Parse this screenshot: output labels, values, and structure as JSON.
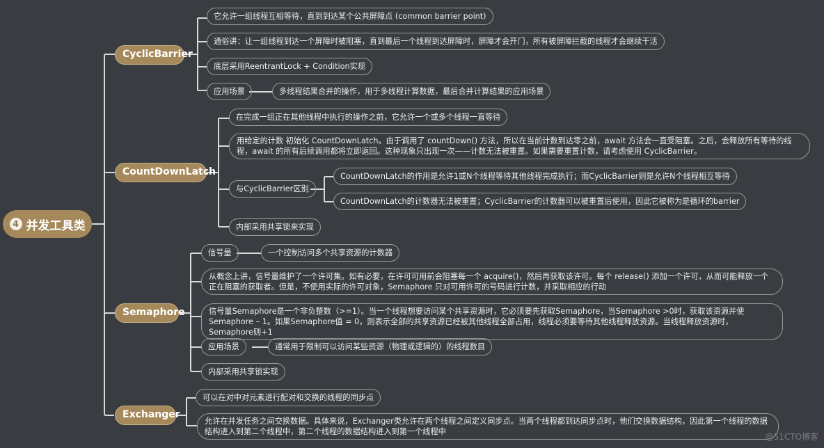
{
  "root": {
    "number": "4",
    "label": "并发工具类"
  },
  "branches": {
    "cyclic": {
      "label": "CyclicBarrier",
      "items": [
        "它允许一组线程互相等待，直到到达某个公共屏障点 (common barrier point)",
        "通俗讲：让一组线程到达一个屏障时被阻塞，直到最后一个线程到达屏障时，屏障才会开门，所有被屏障拦截的线程才会继续干活",
        "底层采用ReentrantLock + Condition实现"
      ],
      "scenario": {
        "label": "应用场景",
        "detail": "多线程结果合并的操作，用于多线程计算数据，最后合并计算结果的应用场景"
      }
    },
    "countdown": {
      "label": "CountDownLatch",
      "items": [
        "在完成一组正在其他线程中执行的操作之前，它允许一个或多个线程一直等待",
        "用给定的计数 初始化 CountDownLatch。由于调用了 countDown() 方法，所以在当前计数到达零之前，await 方法会一直受阻塞。之后，会释放所有等待的线程，await 的所有后续调用都将立即返回。这种现象只出现一次——计数无法被重置。如果需要重置计数，请考虑使用 CyclicBarrier。"
      ],
      "diff": {
        "label": "与CyclicBarrier区别",
        "items": [
          "CountDownLatch的作用是允许1或N个线程等待其他线程完成执行；而CyclicBarrier则是允许N个线程相互等待",
          "CountDownLatch的计数器无法被重置；CyclicBarrier的计数器可以被重置后使用，因此它被称为是循环的barrier"
        ]
      },
      "impl": "内部采用共享锁来实现"
    },
    "semaphore": {
      "label": "Semaphore",
      "signal": {
        "label": "信号量",
        "detail": "一个控制访问多个共享资源的计数器"
      },
      "items": [
        "从概念上讲，信号量维护了一个许可集。如有必要，在许可可用前会阻塞每一个 acquire()，然后再获取该许可。每个 release() 添加一个许可，从而可能释放一个正在阻塞的获取者。但是，不使用实际的许可对象，Semaphore 只对可用许可的号码进行计数，并采取相应的行动",
        "信号量Semaphore是一个非负整数（>=1）。当一个线程想要访问某个共享资源时，它必须要先获取Semaphore，当Semaphore >0时，获取该资源并使Semaphore – 1。如果Semaphore值 = 0，则表示全部的共享资源已经被其他线程全部占用，线程必须要等待其他线程释放资源。当线程释放资源时，Semaphore则+1"
      ],
      "scenario": {
        "label": "应用场景",
        "detail": "通常用于限制可以访问某些资源（物理或逻辑的）的线程数目"
      },
      "impl": "内部采用共享锁实现"
    },
    "exchanger": {
      "label": "Exchanger",
      "items": [
        "可以在对中对元素进行配对和交换的线程的同步点",
        "允许在并发任务之间交换数据。具体来说，Exchanger类允许在两个线程之间定义同步点。当两个线程都到达同步点时，他们交换数据结构，因此第一个线程的数据结构进入到第二个线程中，第二个线程的数据结构进入到第一个线程中"
      ]
    }
  },
  "watermark": "@51CTO博客"
}
